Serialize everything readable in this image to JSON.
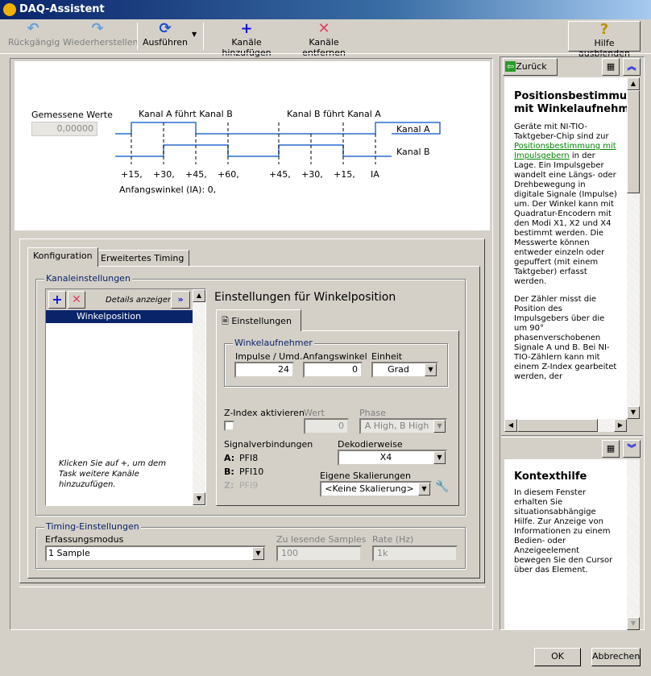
{
  "window": {
    "title": "DAQ-Assistent",
    "help_button": "Hilfe ausblenden"
  },
  "toolbar": {
    "undo": "Rückgängig",
    "redo": "Wiederherstellen",
    "run": "Ausführen",
    "add_channels": "Kanäle hinzufügen",
    "remove_channels": "Kanäle entfernen"
  },
  "diagram": {
    "measured_label": "Gemessene Werte",
    "measured_value": "0,00000",
    "label_a_leads": "Kanal A führt Kanal B",
    "label_b_leads": "Kanal B führt Kanal A",
    "channel_a": "Kanal A",
    "channel_b": "Kanal B",
    "ticks": [
      "+15,",
      "+30,",
      "+45,",
      "+60,",
      "+45,",
      "+30,",
      "+15,",
      "IA"
    ],
    "initial_angle": "Anfangswinkel (IA): 0,"
  },
  "tabs": [
    "Konfiguration",
    "Erweitertes Timing"
  ],
  "channel_settings": {
    "legend": "Kanaleinstellungen",
    "details": "Details anzeigen",
    "channels": [
      "Winkelposition"
    ],
    "hint": "Klicken Sie auf +, um dem Task weitere Kanäle hinzuzufügen."
  },
  "settings": {
    "title": "Einstellungen für Winkelposition",
    "tab": "Einstellungen",
    "encoder_legend": "Winkelaufnehmer",
    "pulses_label": "Impulse / Umd.",
    "pulses_value": "24",
    "initial_angle_label": "Anfangswinkel",
    "initial_angle_value": "0",
    "unit_label": "Einheit",
    "unit_value": "Grad",
    "zindex_label": "Z-Index aktivieren",
    "zindex_checked": false,
    "value_label": "Wert",
    "value_value": "0",
    "phase_label": "Phase",
    "phase_value": "A High, B High",
    "signal_label": "Signalverbindungen",
    "signals": [
      {
        "k": "A:",
        "v": "PFI8"
      },
      {
        "k": "B:",
        "v": "PFI10"
      },
      {
        "k": "Z:",
        "v": "PFI9"
      }
    ],
    "decoding_label": "Dekodierweise",
    "decoding_value": "X4",
    "scaling_label": "Eigene Skalierungen",
    "scaling_value": "<Keine Skalierung>"
  },
  "timing": {
    "legend": "Timing-Einstellungen",
    "mode_label": "Erfassungsmodus",
    "mode_value": "1 Sample",
    "samples_label": "Zu lesende Samples",
    "samples_value": "100",
    "rate_label": "Rate (Hz)",
    "rate_value": "1k"
  },
  "help": {
    "back": "Zurück",
    "title": "Positionsbestimmung mit Winkelaufnehmern",
    "p1_a": "Geräte mit NI-TIO-Taktgeber-Chip sind zur ",
    "p1_link": "Positionsbestimmung mit Impulsgebern",
    "p1_b": " in der Lage. Ein Impulsgeber wandelt eine Längs- oder Drehbewegung in digitale Signale (Impulse) um. Der Winkel kann mit Quadratur-Encodern mit den Modi X1, X2 und X4 bestimmt werden. Die Messwerte können entweder einzeln oder gepuffert (mit einem Taktgeber) erfasst werden.",
    "p2": "Der Zähler misst die Position des Impulsgebers über die um 90° phasenverschobenen Signale A und B. Bei NI-TIO-Zählern kann mit einem Z-Index gearbeitet werden, der",
    "context_title": "Kontexthilfe",
    "context_text": "In diesem Fenster erhalten Sie situationsabhängige Hilfe. Zur Anzeige von Informationen zu einem Bedien- oder Anzeigeelement bewegen Sie den Cursor über das Element."
  },
  "buttons": {
    "ok": "OK",
    "cancel": "Abbrechen"
  }
}
